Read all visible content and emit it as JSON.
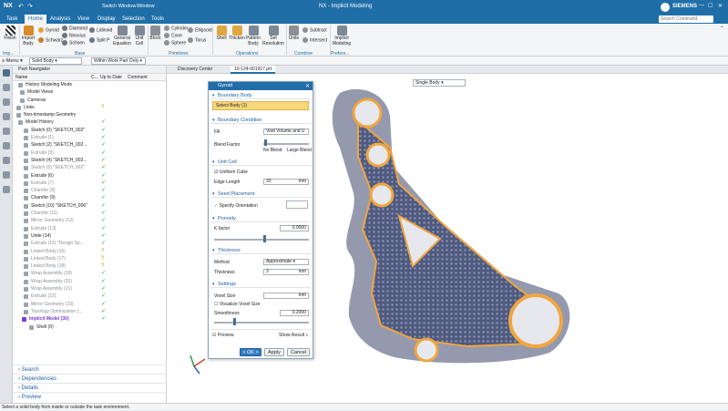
{
  "title_bar": {
    "app": "NX",
    "switch_window": "Switch Window",
    "window": "Window",
    "title": "NX - Implicit Modeling",
    "brand": "SIEMENS",
    "search_placeholder": "Search Command"
  },
  "menu_tabs": [
    "Task",
    "Home",
    "Analysis",
    "View",
    "Display",
    "Selection",
    "Tools"
  ],
  "ribbon": {
    "buttons": {
      "finish": "Finish",
      "import_body": "Import Body",
      "general_equation": "General Equation",
      "unit_cell": "Unit Cell",
      "block": "Block",
      "shell": "Shell",
      "thicken": "Thicken",
      "pattern_body": "Pattern Body",
      "set_resolution": "Set Resolution",
      "unite": "Unite",
      "implicit_modeling": "Implicit Modeling"
    },
    "small": {
      "gyroid": "Gyroid",
      "schwarz": "Schwarz",
      "diamond": "Diamond",
      "neovius": "Neovius",
      "schoen": "Schoen",
      "lidinoid": "Lidinoid",
      "split_p": "Split P",
      "cylinder": "Cylinder",
      "cone": "Cone",
      "sphere": "Sphere",
      "ellipsoid": "Ellipsoid",
      "torus": "Torus",
      "subtract": "Subtract",
      "intersect": "Intersect"
    },
    "groups": {
      "imp": "Imp...",
      "base": "Base",
      "primitives": "Primitives",
      "operations": "Operations",
      "combine": "Combine",
      "prefere": "Prefere..."
    }
  },
  "filter_bar": {
    "menu": "Menu",
    "type_filter": "Solid Body",
    "scope": "Within Work Part Only"
  },
  "part_navigator": {
    "title": "Part Navigator",
    "columns": {
      "name": "Name",
      "c": "C...",
      "up_to_date": "Up to Date",
      "comment": "Comment"
    },
    "rows": [
      {
        "label": "History Modeling Mode",
        "mark": ""
      },
      {
        "label": "Model Views",
        "mark": ""
      },
      {
        "label": "Cameras",
        "mark": ""
      },
      {
        "label": "Links",
        "mark": "?"
      },
      {
        "label": "Non-timestamp Geometry",
        "mark": ""
      },
      {
        "label": "Model History",
        "mark": "✓"
      },
      {
        "label": "Sketch (0) \"SKETCH_002\"",
        "mark": "✓"
      },
      {
        "label": "Extrude (1)",
        "mark": "✓"
      },
      {
        "label": "Sketch (2) \"SKETCH_002...",
        "mark": "✓"
      },
      {
        "label": "Extrude (3)",
        "mark": "✓"
      },
      {
        "label": "Sketch (4) \"SKETCH_002...",
        "mark": "✓"
      },
      {
        "label": "Sketch (5) \"SKETCH_002\"",
        "mark": "✓"
      },
      {
        "label": "Extrude (6)",
        "mark": "✓"
      },
      {
        "label": "Extrude (7)",
        "mark": "✓"
      },
      {
        "label": "Chamfer (8)",
        "mark": "✓"
      },
      {
        "label": "Chamfer (9)",
        "mark": "✓"
      },
      {
        "label": "Sketch (10) \"SKETCH_006\"",
        "mark": "✓"
      },
      {
        "label": "Chamfer (11)",
        "mark": "✓"
      },
      {
        "label": "Mirror Geometry (12)",
        "mark": "✓"
      },
      {
        "label": "Extrude (13)",
        "mark": "✓"
      },
      {
        "label": "Unite (14)",
        "mark": "✓"
      },
      {
        "label": "Extrude (15) \"Design Sp...",
        "mark": "✓"
      },
      {
        "label": "Linked Body (16)",
        "mark": "?"
      },
      {
        "label": "Linked Body (17)",
        "mark": "?"
      },
      {
        "label": "Linked Body (18)",
        "mark": "?"
      },
      {
        "label": "Wrap Assembly (19)",
        "mark": "✓"
      },
      {
        "label": "Wrap Assembly (20)",
        "mark": "✓"
      },
      {
        "label": "Wrap Assembly (21)",
        "mark": "✓"
      },
      {
        "label": "Extrude (22)",
        "mark": "✓"
      },
      {
        "label": "Mirror Geometry (23)",
        "mark": "✓"
      },
      {
        "label": "Topology Optimization (...",
        "mark": "✓"
      },
      {
        "label": "Implicit Model (30)",
        "mark": "✓"
      },
      {
        "label": "Shell (0)",
        "mark": ""
      }
    ],
    "sections": [
      "Search",
      "Dependencies",
      "Details",
      "Preview"
    ]
  },
  "viewport": {
    "tabs": {
      "discovery": "Discovery Center",
      "file": "10-124-001917.prt"
    },
    "body_filter": "Single Body"
  },
  "dialog": {
    "title": "Gyroid",
    "boundary_body": "Boundary Body",
    "select_body": "Select Body (1)",
    "boundary_condition": "Boundary Condition",
    "fill_label": "Fill",
    "fill_value": "Void Volume and U",
    "blend_factor": "Blend Factor",
    "no_blend": "No Blend",
    "large_blend": "Large Blend",
    "unit_cell": "Unit Cell",
    "uniform_cube": "Uniform Cube",
    "edge_length_label": "Edge Length",
    "edge_length_value": "20",
    "edge_unit": "mm",
    "seed_placement": "Seed Placement",
    "specify_orientation": "Specify Orientation",
    "porosity": "Porosity",
    "k_factor_label": "K factor",
    "k_factor_value": "0.0000",
    "thickness_section": "Thickness",
    "method_label": "Method",
    "method_value": "Approximate",
    "thickness_label": "Thickness",
    "thickness_value": "3",
    "thickness_unit": "mm",
    "settings": "Settings",
    "voxel_size_label": "Voxel Size",
    "voxel_size_value": "",
    "voxel_unit": "mm",
    "visualize_voxel_size": "Visualize Voxel Size",
    "smoothness_label": "Smoothness",
    "smoothness_value": "0.2000",
    "preview": "Preview",
    "show_result": "Show Result",
    "ok": "< OK >",
    "apply": "Apply",
    "cancel": "Cancel",
    "k_factor_slider": 0.52,
    "blend_slider": 0.02,
    "smoothness_slider": 0.2
  },
  "status_bar": {
    "message": "Select a solid body from inside or outside the task environment."
  },
  "colors": {
    "brand": "#1f6ea8",
    "accent_orange": "#f0a640",
    "model_gray": "#8e94a6",
    "lattice_blue": "#4a5678"
  }
}
